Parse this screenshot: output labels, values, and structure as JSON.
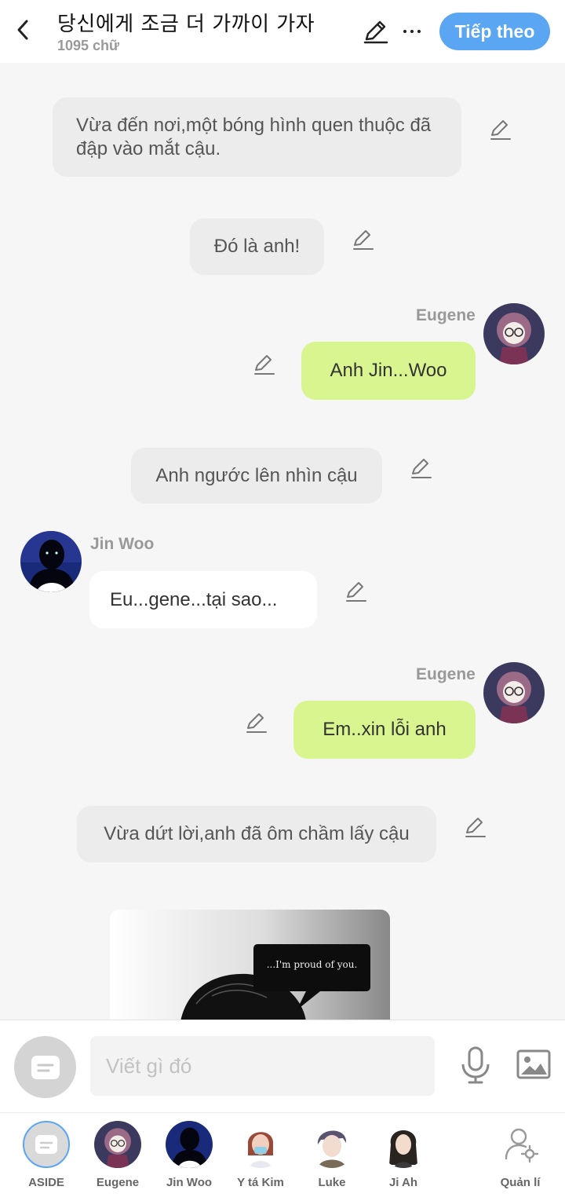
{
  "header": {
    "title": "당신에게 조금 더 가까이 가자",
    "word_count": "1095 chữ",
    "next_label": "Tiếp theo"
  },
  "messages": {
    "m1": "Vừa đến nơi,một bóng hình quen thuộc đã đập vào mắt cậu.",
    "m2": "Đó là anh!",
    "m3_name": "Eugene",
    "m3": "Anh Jin...Woo",
    "m4": "Anh ngước lên nhìn cậu",
    "m5_name": "Jin Woo",
    "m5": "Eu...gene...tại sao...",
    "m6_name": "Eugene",
    "m6": "Em..xin lỗi anh",
    "m7": "Vừa dứt lời,anh đã ôm chầm lấy cậu",
    "image_caption": "...I'm proud of you."
  },
  "composer": {
    "placeholder": "Viết gì đó"
  },
  "characters": [
    {
      "label": "ASIDE"
    },
    {
      "label": "Eugene"
    },
    {
      "label": "Jin Woo"
    },
    {
      "label": "Y tá Kim"
    },
    {
      "label": "Luke"
    },
    {
      "label": "Ji Ah"
    },
    {
      "label": "Quản lí"
    }
  ],
  "colors": {
    "accent": "#5aa6f2",
    "my_bubble": "#d8f590",
    "narration_bubble": "#ececec"
  }
}
